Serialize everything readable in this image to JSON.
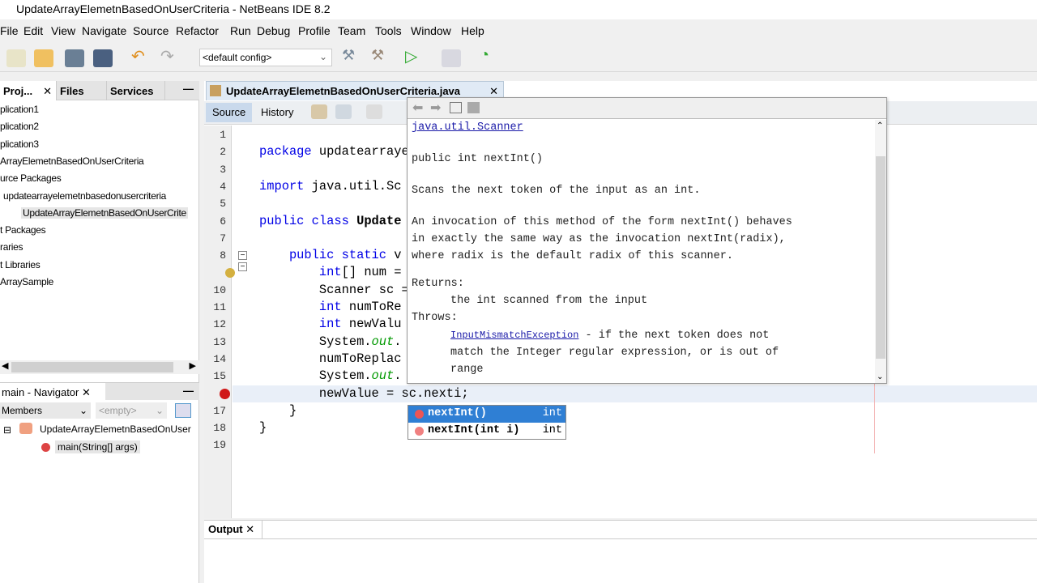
{
  "window": {
    "title": "UpdateArrayElemetnBasedOnUserCriteria - NetBeans IDE 8.2"
  },
  "menu": [
    "File",
    "Edit",
    "View",
    "Navigate",
    "Source",
    "Refactor",
    "Run",
    "Debug",
    "Profile",
    "Team",
    "Tools",
    "Window",
    "Help"
  ],
  "toolbar": {
    "config": "<default config>"
  },
  "left_panel": {
    "tabs": [
      "Proj...",
      "Files",
      "Services"
    ],
    "tree": [
      "plication1",
      "plication2",
      "plication3",
      "ArrayElemetnBasedOnUserCriteria",
      "urce Packages",
      "updatearrayelemetnbasedonusercriteria",
      "UpdateArrayElemetnBasedOnUserCrite",
      "t Packages",
      "raries",
      "t Libraries",
      "ArraySample"
    ]
  },
  "navigator": {
    "title": "main - Navigator",
    "members": "Members",
    "filter": "<empty>",
    "class_node": "UpdateArrayElemetnBasedOnUser",
    "method_node": "main(String[] args)"
  },
  "editor": {
    "tab": "UpdateArrayElemetnBasedOnUserCriteria.java",
    "source_tab": "Source",
    "history_tab": "History",
    "lines": [
      [],
      [
        [
          "package ",
          "kw"
        ],
        [
          "updatearraye",
          ""
        ]
      ],
      [],
      [
        [
          "import ",
          "kw"
        ],
        [
          "java.util.Sc",
          ""
        ]
      ],
      [],
      [
        [
          "public class ",
          "kw"
        ],
        [
          "Update",
          ""
        ]
      ],
      [],
      [
        [
          "    public static ",
          "kw"
        ],
        [
          "v",
          ""
        ]
      ],
      [
        [
          "        int",
          "kw"
        ],
        [
          "[] num =",
          ""
        ]
      ],
      [
        [
          "        Scanner sc =",
          ""
        ]
      ],
      [
        [
          "        int ",
          "kw"
        ],
        [
          "numToRe",
          ""
        ]
      ],
      [
        [
          "        int ",
          "kw"
        ],
        [
          "newValu",
          ""
        ]
      ],
      [
        [
          "        System.",
          ""
        ],
        [
          "out",
          "fld"
        ],
        [
          ".",
          ""
        ]
      ],
      [
        [
          "        numToReplac",
          ""
        ]
      ],
      [
        [
          "        System.",
          ""
        ],
        [
          "out",
          "fld"
        ],
        [
          ".",
          ""
        ]
      ],
      [
        [
          "        newValue = sc.nexti;",
          ""
        ]
      ],
      [
        [
          "    }",
          ""
        ]
      ],
      [
        [
          "}",
          ""
        ]
      ],
      []
    ]
  },
  "doc": {
    "class_link": "java.util.Scanner",
    "signature": "public int nextInt()",
    "summary": "Scans the next token of the input as an int.",
    "desc": [
      "An invocation of this method of the form nextInt() behaves",
      "in exactly the same way as the invocation nextInt(radix),",
      "where radix is the default radix of this scanner."
    ],
    "returns_label": "Returns:",
    "returns": "the int scanned from the input",
    "throws_label": "Throws:",
    "exception": "InputMismatchException",
    "throws_desc": [
      " - if the next token does not",
      "match the Integer regular expression, or is out of",
      "range"
    ]
  },
  "completion": [
    {
      "name": "nextInt()",
      "type": "int"
    },
    {
      "name": "nextInt(int i)",
      "type": "int"
    }
  ],
  "output": {
    "tab": "Output"
  }
}
